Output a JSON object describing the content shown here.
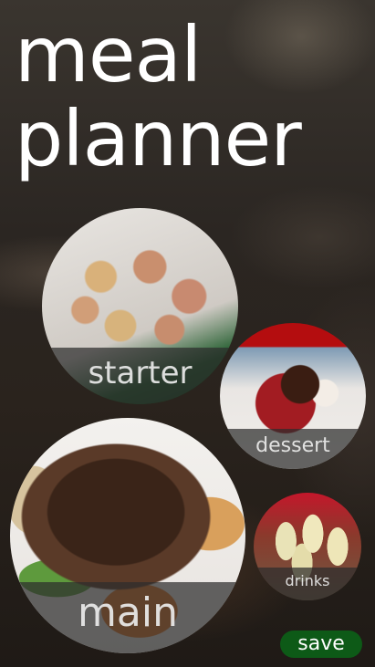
{
  "app": {
    "title_line1": "meal",
    "title_line2": "planner"
  },
  "categories": [
    {
      "id": "starter",
      "label": "starter"
    },
    {
      "id": "dessert",
      "label": "dessert"
    },
    {
      "id": "main",
      "label": "main"
    },
    {
      "id": "drinks",
      "label": "drinks"
    }
  ],
  "actions": {
    "save_label": "save"
  },
  "colors": {
    "title_text": "#ffffff",
    "save_button_bg": "#0d5a17",
    "label_overlay": "#2d2d2d"
  }
}
